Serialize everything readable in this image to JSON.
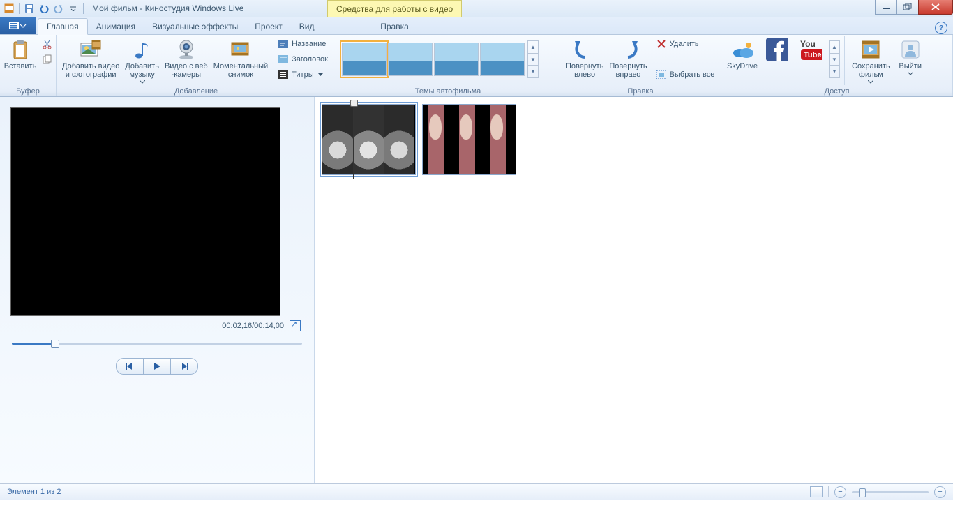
{
  "title": "Мой фильм - Киностудия Windows Live",
  "context_tab": "Средства для работы с видео",
  "tabs": {
    "main": "Главная",
    "anim": "Анимация",
    "fx": "Визуальные эффекты",
    "project": "Проект",
    "view": "Вид",
    "edit": "Правка"
  },
  "groups": {
    "buffer": "Буфер",
    "add": "Добавление",
    "themes": "Темы автофильма",
    "editing": "Правка",
    "share": "Доступ"
  },
  "buttons": {
    "paste": "Вставить",
    "add_media": "Добавить видео\nи фотографии",
    "add_music": "Добавить\nмузыку",
    "webcam": "Видео с веб\n-камеры",
    "snapshot": "Моментальный\nснимок",
    "title": "Название",
    "header": "Заголовок",
    "credits": "Титры",
    "rotate_left": "Повернуть\nвлево",
    "rotate_right": "Повернуть\nвправо",
    "delete": "Удалить",
    "select_all": "Выбрать все",
    "skydrive": "SkyDrive",
    "save_movie": "Сохранить\nфильм",
    "exit": "Выйти"
  },
  "preview": {
    "time": "00:02,16/00:14,00"
  },
  "status": {
    "text": "Элемент 1 из 2"
  }
}
